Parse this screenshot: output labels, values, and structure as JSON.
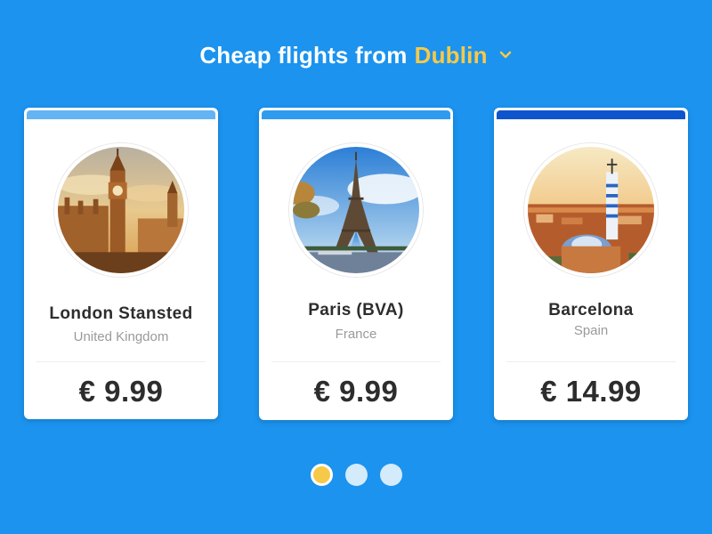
{
  "header": {
    "prefix": "Cheap flights from",
    "city": "Dublin",
    "chevron_icon": "chevron-down-icon",
    "accent_color": "#f7c948"
  },
  "colors": {
    "background": "#1b93ef",
    "card_bar_1": "#64b3f4",
    "card_bar_2": "#2f9bef",
    "card_bar_3": "#0c55cc"
  },
  "cards": [
    {
      "name": "London Stansted",
      "country": "United Kingdom",
      "price": "€ 9.99",
      "image": "big-ben-photo"
    },
    {
      "name": "Paris (BVA)",
      "country": "France",
      "price": "€ 9.99",
      "image": "eiffel-tower-photo"
    },
    {
      "name": "Barcelona",
      "country": "Spain",
      "price": "€ 14.99",
      "image": "park-guell-photo"
    }
  ],
  "pagination": {
    "total": 3,
    "active_index": 0
  }
}
